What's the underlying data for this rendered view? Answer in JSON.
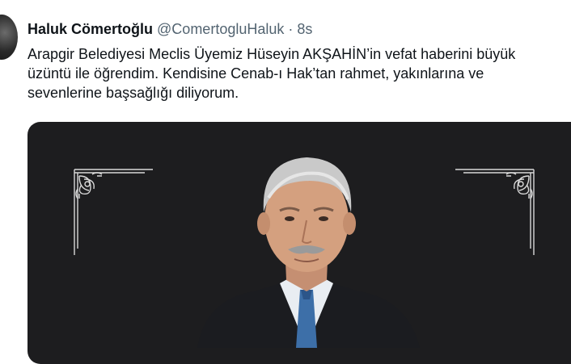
{
  "tweet": {
    "author_name": "Haluk Cömertoğlu",
    "author_handle": "@ComertogluHaluk",
    "separator": "·",
    "time": "8s",
    "text_lines": [
      "Arapgir Belediyesi Meclis Üyemiz Hüseyin AKŞAHİN’in vefat haberini büyük",
      "üzüntü ile öğrendim. Kendisine Cenab-ı Hak’tan rahmet, yakınlarına ve",
      "sevenlerine başsağlığı diliyorum."
    ]
  },
  "media": {
    "background_color": "#1d1d1f",
    "ornament_color": "#d9d9d9"
  },
  "colors": {
    "text": "#0f1419",
    "secondary_text": "#536471"
  }
}
